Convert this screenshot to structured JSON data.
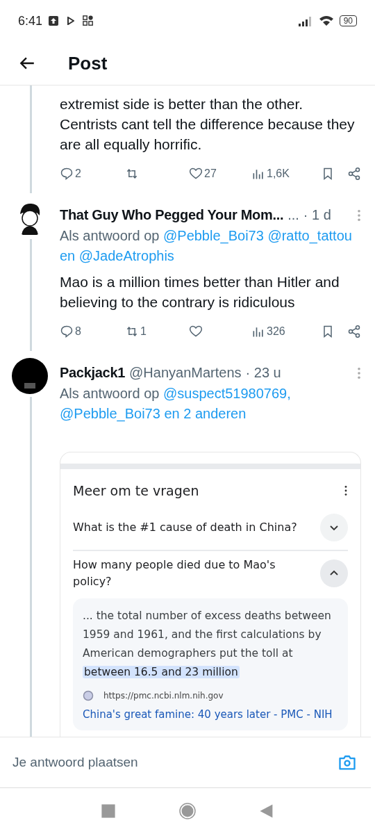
{
  "status_bar": {
    "time": "6:41",
    "battery": "90"
  },
  "header": {
    "title": "Post"
  },
  "posts": [
    {
      "kind": "thread_tail",
      "body": "extremist side is better than the other. Centrists cant tell the difference because they are all equally horrific.",
      "stats": {
        "replies": "2",
        "likes": "27",
        "views": "1,6K"
      }
    },
    {
      "kind": "reply",
      "name": "That Guy Who Pegged Your Mom...",
      "handle": "...",
      "time": "· 1 d",
      "reply_prefix": "Als antwoord op",
      "reply_to": [
        "@Pebble_Boi73",
        "@ratto_tattou",
        "en @JadeAtrophis"
      ],
      "body": "Mao is a million times better than Hitler and believing to the contrary is ridiculous",
      "stats": {
        "replies": "8",
        "reposts": "1",
        "views": "326"
      }
    },
    {
      "kind": "reply",
      "name": "Packjack1",
      "handle": "@HanyanMartens",
      "time": "· 23 u",
      "reply_prefix": "Als antwoord op",
      "reply_to": [
        "@suspect51980769,",
        "@Pebble_Boi73",
        "en 2 anderen"
      ],
      "attachment": {
        "heading": "Meer om te vragen",
        "questions": [
          {
            "text": "What is the #1 cause of death in China?",
            "expanded": false
          },
          {
            "text": "How many people died due to Mao's policy?",
            "expanded": true,
            "answer": {
              "text": "... the total number of excess deaths between 1959 and 1961, and the first calculations by American demographers put the toll at",
              "highlight": "between 16.5 and 23 million",
              "source_url": "https://pmc.ncbi.nlm.nih.gov",
              "source_title": "China's great famine: 40 years later - PMC - NIH"
            }
          }
        ]
      }
    }
  ],
  "composer": {
    "placeholder": "Je antwoord plaatsen"
  }
}
